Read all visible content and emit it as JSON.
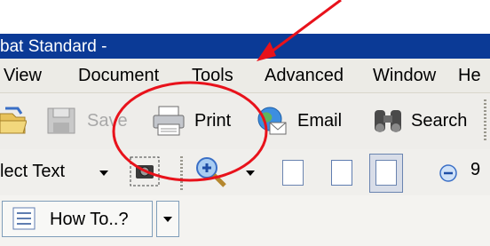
{
  "title_bar": {
    "text": "bat Standard -"
  },
  "menu": {
    "items": [
      "View",
      "Document",
      "Tools",
      "Advanced",
      "Window",
      "He"
    ]
  },
  "toolbar": {
    "save_label": "Save",
    "print_label": "Print",
    "email_label": "Email",
    "search_label": "Search"
  },
  "select_tool": {
    "label": "lect Text"
  },
  "zoom": {
    "value": "9"
  },
  "howto": {
    "label": "How To..?"
  },
  "colors": {
    "title_bar": "#0b3a96",
    "annotation": "#e8121b",
    "menu_bg": "#ecebe6",
    "toolbar_bg": "#eeedea"
  }
}
